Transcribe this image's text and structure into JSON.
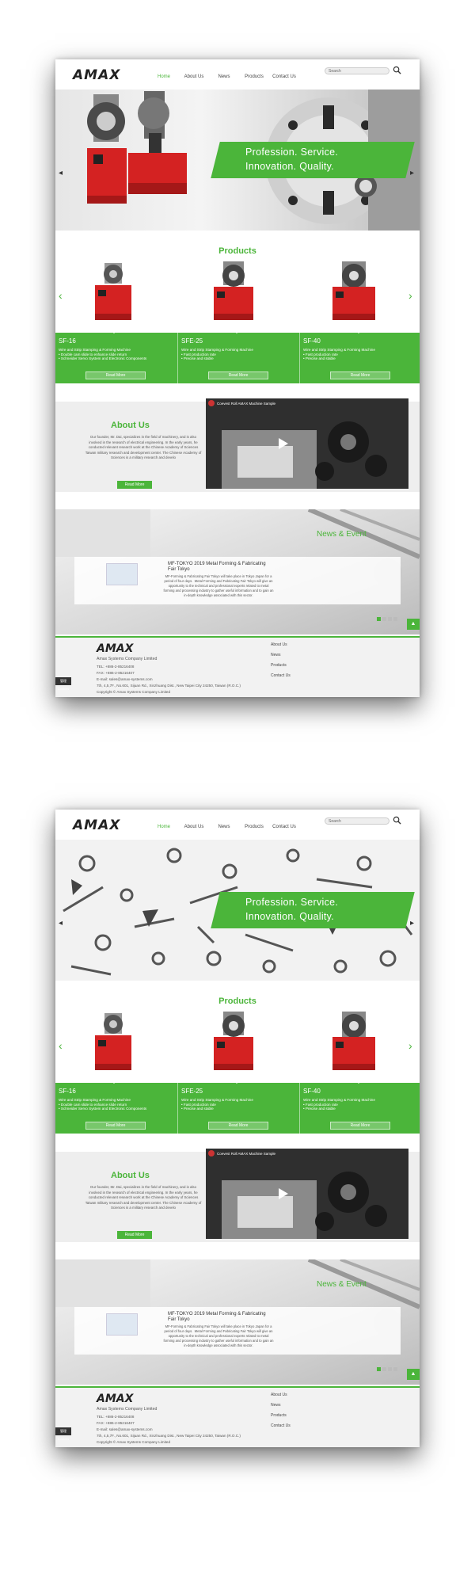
{
  "brand": "AMAX",
  "nav": [
    "Home",
    "About Us",
    "News",
    "Products",
    "Contact Us"
  ],
  "search_placeholder": "Search",
  "slogan": {
    "line1": "Profession. Service.",
    "line2": "Innovation. Quality."
  },
  "products_title": "Products",
  "products": [
    {
      "name": "SF-16",
      "desc": [
        "Wire and Strip Stamping & Forming Machine",
        "Double cam slide to enhance slide return",
        "Schneider Servo System and Electronic Components"
      ],
      "btn": "Read More"
    },
    {
      "name": "SFE-25",
      "desc": [
        "Wire and Strip Stamping & Forming Machine",
        "Fast production rate",
        "Precise and stable"
      ],
      "btn": "Read More"
    },
    {
      "name": "SF-40",
      "desc": [
        "Wire and Strip Stamping & Forming Machine",
        "Fast production rate",
        "Precise and stable"
      ],
      "btn": "Read More"
    }
  ],
  "about": {
    "title": "About Us",
    "text": "Our founder, Mr. Dai, specializes in the field of machinery, and is also involved in the research of electrical engineering. In the early years, he conducted relevant research work at the Chinese Academy of Sciences Taiwan military research and development center. The Chinese Academy of Sciences is a military research and develo",
    "btn": "Read More",
    "video_title": "Coevest Roll AMAX Machine Sample"
  },
  "news": {
    "title": "News & Event",
    "item_title": "MF-TOKYO 2019 Metal Forming & Fabricating Fair Tokyo",
    "item_text": "MF-Forming & Fabricating Fair Tokyo will take place in Tokyo Japan for a period of four days.  Metal Forming and Fabricating Fair Tokyo will give an opportunity to the technical and professional experts related to metal forming and processing industry to gather useful information and to gain an in-depth knowledge associated with this sector."
  },
  "footer": {
    "company": "Amax Systems Company Limited",
    "tel": "TEL: +886-2-85216408",
    "fax": "FAX: +886-2-85216407",
    "email": "E-mail: sales@amax-systems.com",
    "addr": "7th, 4,5,7F., No.601, Sijuan Rd., Xinzhuang Dist., New Taipei City 24250, Taiwan (R.O.C.)",
    "copy": "Copyright © Amax Systems Company Limited",
    "links": [
      "About Us",
      "News",
      "Products",
      "Contact Us"
    ],
    "cookie": "管理 Cookies"
  }
}
